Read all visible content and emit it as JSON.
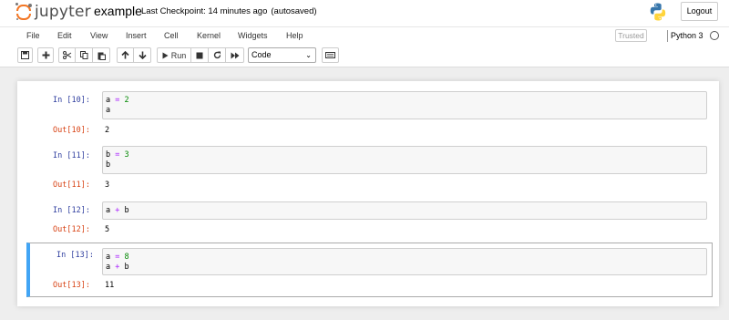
{
  "header": {
    "logo_text": "jupyter",
    "notebook_title": "example",
    "checkpoint": "Last Checkpoint: 14 minutes ago",
    "autosave": "(autosaved)",
    "logout_label": "Logout"
  },
  "menubar": {
    "items": [
      "File",
      "Edit",
      "View",
      "Insert",
      "Cell",
      "Kernel",
      "Widgets",
      "Help"
    ],
    "trusted_label": "Trusted",
    "kernel_name": "Python 3"
  },
  "toolbar": {
    "run_label": "Run",
    "cell_type": "Code"
  },
  "cells": [
    {
      "in_prompt": "In [10]:",
      "code": [
        [
          {
            "t": "a",
            "c": ""
          },
          {
            "t": " = ",
            "c": "op"
          },
          {
            "t": "2",
            "c": "num"
          }
        ],
        [
          {
            "t": "a",
            "c": ""
          }
        ]
      ],
      "out_prompt": "Out[10]:",
      "output": "2"
    },
    {
      "in_prompt": "In [11]:",
      "code": [
        [
          {
            "t": "b",
            "c": ""
          },
          {
            "t": " = ",
            "c": "op"
          },
          {
            "t": "3",
            "c": "num"
          }
        ],
        [
          {
            "t": "b",
            "c": ""
          }
        ]
      ],
      "out_prompt": "Out[11]:",
      "output": "3"
    },
    {
      "in_prompt": "In [12]:",
      "code": [
        [
          {
            "t": "a",
            "c": ""
          },
          {
            "t": " + ",
            "c": "op"
          },
          {
            "t": "b",
            "c": ""
          }
        ]
      ],
      "out_prompt": "Out[12]:",
      "output": "5"
    },
    {
      "in_prompt": "In [13]:",
      "code": [
        [
          {
            "t": "a",
            "c": ""
          },
          {
            "t": " = ",
            "c": "op"
          },
          {
            "t": "8",
            "c": "num"
          }
        ],
        [
          {
            "t": "a",
            "c": ""
          },
          {
            "t": " + ",
            "c": "op"
          },
          {
            "t": "b",
            "c": ""
          }
        ]
      ],
      "out_prompt": "Out[13]:",
      "output": "11"
    }
  ],
  "colors": {
    "selected_cell_accent": "#42a5f5",
    "in_prompt": "#303f9f",
    "out_prompt": "#d84315",
    "logo_orange": "#f37726"
  }
}
